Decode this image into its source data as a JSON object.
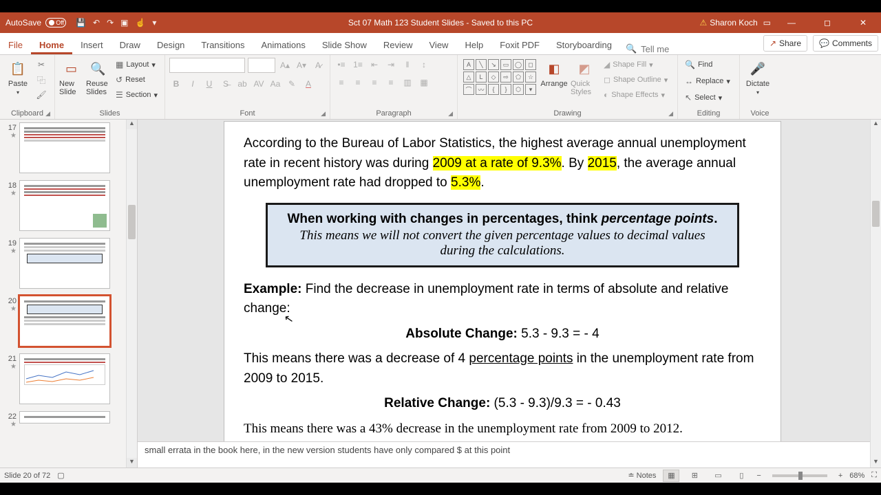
{
  "titlebar": {
    "autosave_label": "AutoSave",
    "autosave_state": "Off",
    "document": "Sct 07 Math 123 Student Slides",
    "save_state": "Saved to this PC",
    "user": "Sharon Koch"
  },
  "tabs": {
    "file": "File",
    "home": "Home",
    "insert": "Insert",
    "draw": "Draw",
    "design": "Design",
    "transitions": "Transitions",
    "animations": "Animations",
    "slideshow": "Slide Show",
    "review": "Review",
    "view": "View",
    "help": "Help",
    "foxit": "Foxit PDF",
    "storyboarding": "Storyboarding",
    "tellme": "Tell me",
    "share": "Share",
    "comments": "Comments"
  },
  "ribbon": {
    "clipboard": {
      "paste": "Paste",
      "label": "Clipboard"
    },
    "slides": {
      "new": "New Slide",
      "reuse": "Reuse Slides",
      "layout": "Layout",
      "reset": "Reset",
      "section": "Section",
      "label": "Slides"
    },
    "font": {
      "label": "Font"
    },
    "paragraph": {
      "label": "Paragraph"
    },
    "drawing": {
      "arrange": "Arrange",
      "quick": "Quick Styles",
      "fill": "Shape Fill",
      "outline": "Shape Outline",
      "effects": "Shape Effects",
      "label": "Drawing"
    },
    "editing": {
      "find": "Find",
      "replace": "Replace",
      "select": "Select",
      "label": "Editing"
    },
    "voice": {
      "dictate": "Dictate",
      "label": "Voice"
    }
  },
  "thumbs": {
    "items": [
      {
        "n": "17"
      },
      {
        "n": "18"
      },
      {
        "n": "19"
      },
      {
        "n": "20"
      },
      {
        "n": "21"
      },
      {
        "n": "22"
      }
    ],
    "selected": "20"
  },
  "slide": {
    "p1a": "According to the Bureau of Labor Statistics, the highest average annual unemployment rate in recent history was during ",
    "p1_hl1": "2009 at a rate of 9.3%",
    "p1b": ". By ",
    "p1_hl2": "2015",
    "p1c": ", the average annual unemployment rate had dropped to ",
    "p1_hl3": "5.3%",
    "p1d": ".",
    "callout1_a": "When working with changes in percentages, think ",
    "callout1_b": "percentage points",
    "callout1_c": ".",
    "callout2": "This means we will not convert the given percentage values to decimal values during the calculations.",
    "example_label": "Example:",
    "example_text": " Find the decrease in unemployment rate in terms of absolute and relative change:",
    "abs_label": "Absolute Change:",
    "abs_val": " 5.3 - 9.3 = - 4",
    "abs_expl_a": "This means there was a decrease of 4 ",
    "abs_expl_u": "percentage points",
    "abs_expl_b": " in the unemployment rate from 2009 to 2015.",
    "rel_label": "Relative Change:",
    "rel_val": "  (5.3 - 9.3)/9.3 = - 0.43",
    "rel_expl": "This means there was a 43% decrease in the unemployment rate from 2009 to 2012."
  },
  "notes": "small errata in the book here, in the new version students have only compared $ at this point",
  "status": {
    "slide": "Slide 20 of 72",
    "notes": "Notes",
    "zoom": "68%"
  }
}
